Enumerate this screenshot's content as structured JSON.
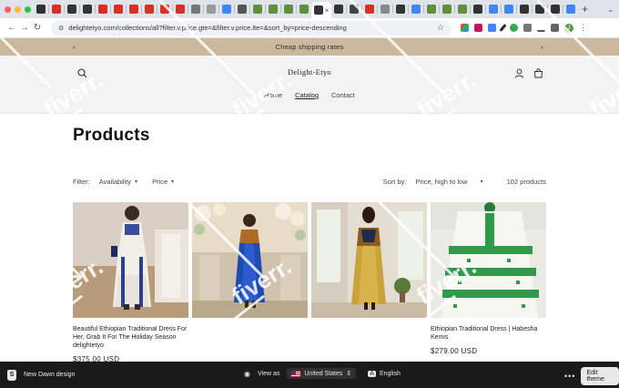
{
  "browser": {
    "url": "delightetyo.com/collections/all?filter.v.price.gte=&filter.v.price.lte=&sort_by=price-descending"
  },
  "announcement": {
    "text": "Cheap shipping rates"
  },
  "header": {
    "logo": "Delight-Etyo",
    "nav": [
      "Home",
      "Catalog",
      "Contact"
    ]
  },
  "collection": {
    "title": "Products",
    "filter_label": "Filter:",
    "filter_availability": "Availability",
    "filter_price": "Price",
    "sort_label": "Sort by:",
    "sort_value": "Price, high to low",
    "count": "102 products"
  },
  "products": [
    {
      "title": "Beautiful Ethiopian Traditional Dress For Her, Grab It For The Holiday Season delightetyo",
      "price": "$375.00 USD"
    },
    {
      "title": "",
      "price": ""
    },
    {
      "title": "",
      "price": ""
    },
    {
      "title": "Ethiopian Traditional Dress | Habesha Kemis",
      "price": "$279.00 USD"
    }
  ],
  "editor_bar": {
    "theme_name": "New Dawn design",
    "view_as": "View as",
    "country": "United States",
    "language": "English",
    "edit_button": "Edit theme"
  },
  "watermark": "fiverr.",
  "colors": {
    "announcement_bg": "#cbb89d",
    "header_bg": "#f3f3f3",
    "editor_bar_bg": "#1a1a1a"
  }
}
